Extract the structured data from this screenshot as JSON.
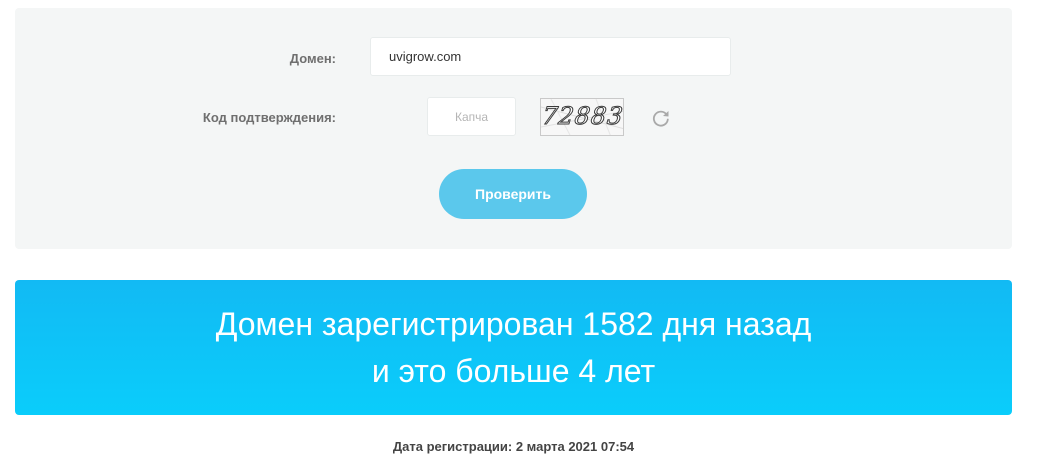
{
  "form": {
    "domain_label": "Домен:",
    "domain_value": "uvigrow.com",
    "captcha_label": "Код подтверждения:",
    "captcha_placeholder": "Капча",
    "captcha_code": "72883",
    "refresh_icon": "refresh-icon",
    "submit_label": "Проверить"
  },
  "result": {
    "line1": "Домен зарегистрирован 1582 дня назад",
    "line2": "и это больше 4 лет"
  },
  "registration": {
    "label": "Дата регистрации: 2 марта 2021 07:54"
  },
  "colors": {
    "panel_bg": "#f4f6f6",
    "button_bg": "#5bc8ec",
    "banner_bg": "#0ac4f8"
  }
}
